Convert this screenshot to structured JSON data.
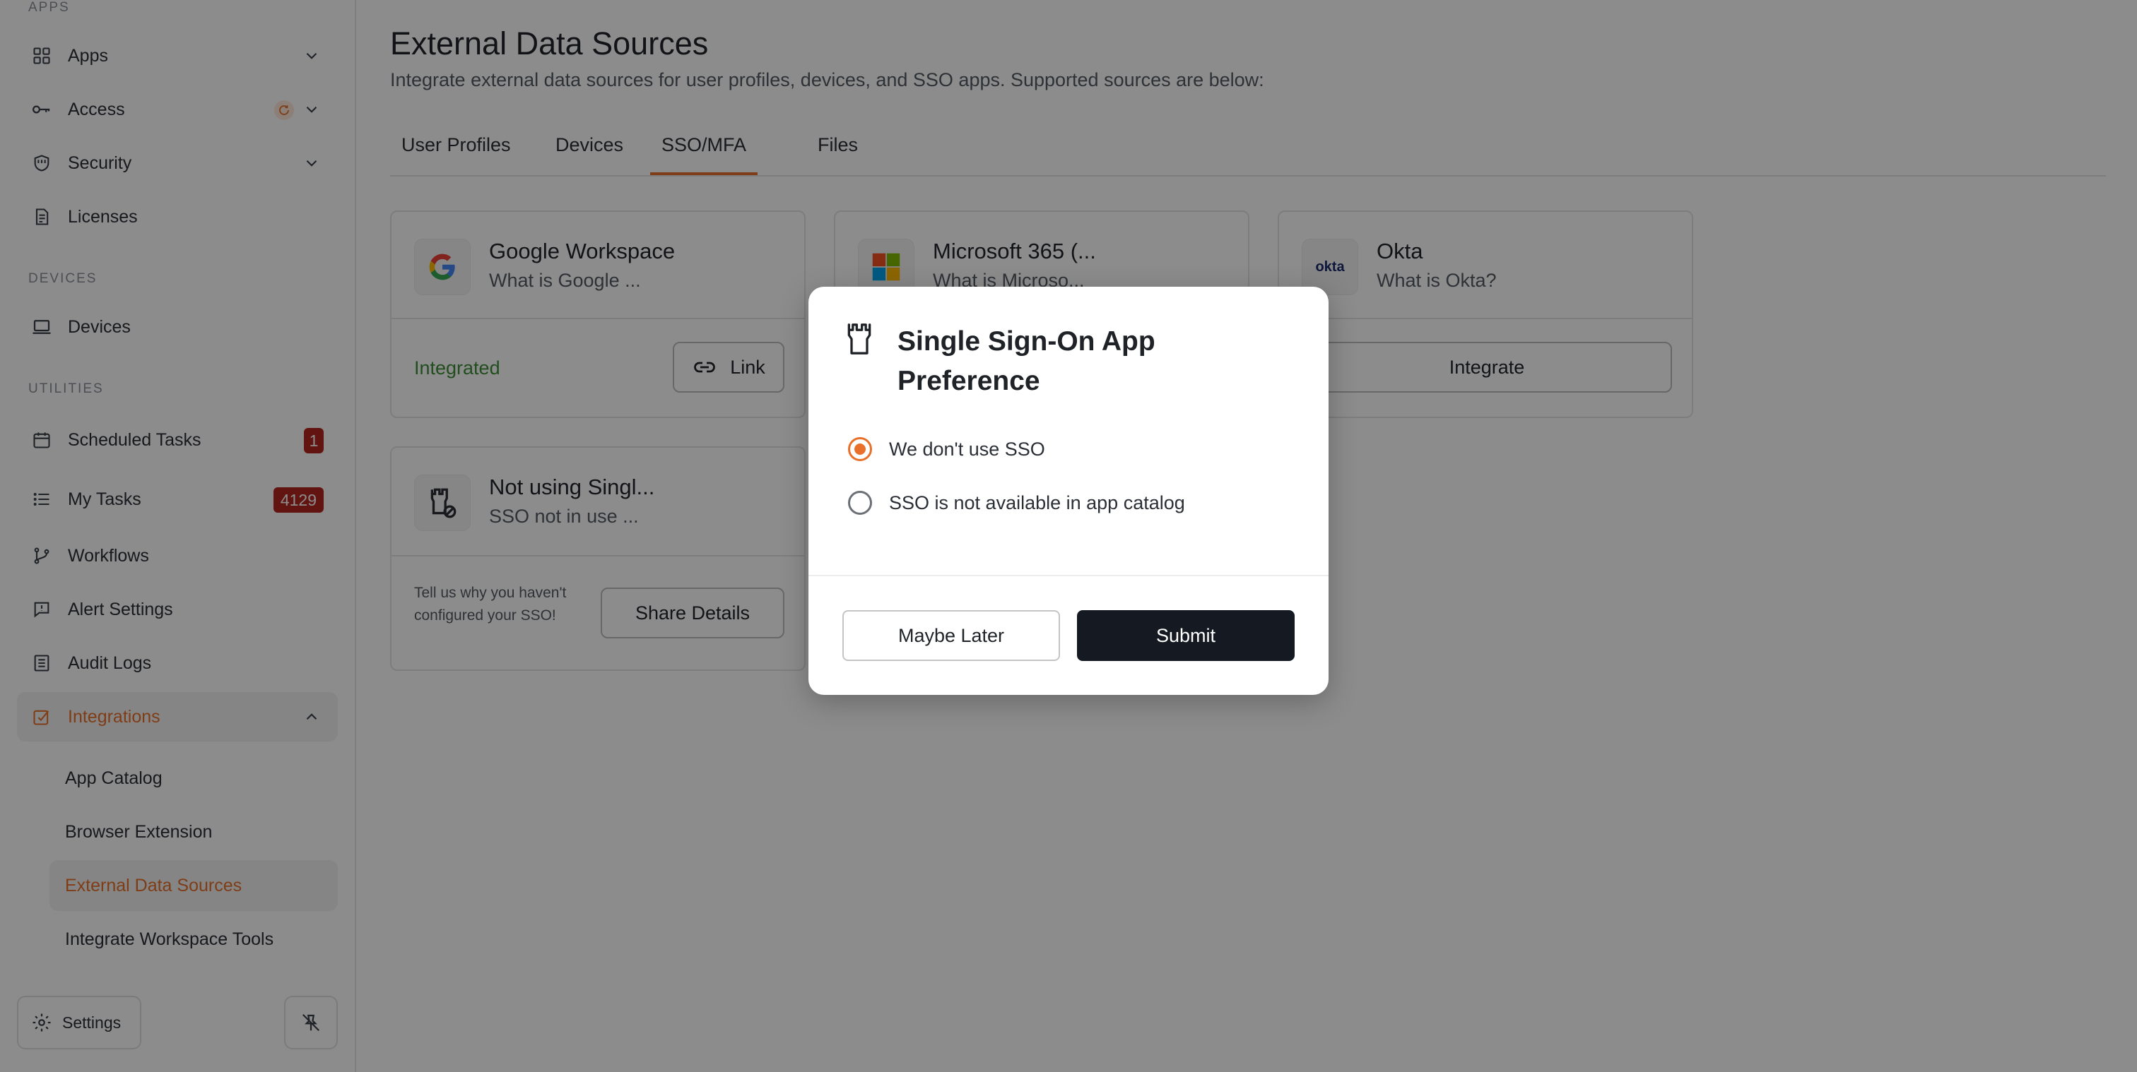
{
  "sidebar": {
    "sections": {
      "apps": "APPS",
      "devices": "DEVICES",
      "utilities": "UTILITIES"
    },
    "items": {
      "apps": "Apps",
      "access": "Access",
      "security": "Security",
      "licenses": "Licenses",
      "devices": "Devices",
      "scheduled_tasks": "Scheduled Tasks",
      "scheduled_tasks_badge": "1",
      "my_tasks": "My Tasks",
      "my_tasks_badge": "4129",
      "workflows": "Workflows",
      "alert_settings": "Alert Settings",
      "audit_logs": "Audit Logs",
      "integrations": "Integrations"
    },
    "sub_items": {
      "app_catalog": "App Catalog",
      "browser_extension": "Browser Extension",
      "external_data_sources": "External Data Sources",
      "integrate_workspace_tools": "Integrate Workspace Tools"
    },
    "settings_label": "Settings",
    "accent_color": "#e8702a"
  },
  "main": {
    "title": "External Data Sources",
    "subtitle": "Integrate external data sources for user profiles, devices, and SSO apps. Supported sources are below:",
    "tabs": [
      "User Profiles",
      "Devices",
      "SSO/MFA",
      "Files"
    ],
    "active_tab": "SSO/MFA",
    "cards": [
      {
        "name": "Google Workspace",
        "desc": "What is Google ...",
        "status": "Integrated",
        "action": "Link"
      },
      {
        "name": "Microsoft 365 (...",
        "desc": "What is Microso..."
      },
      {
        "name": "Okta",
        "desc": "What is Okta?",
        "action": "Integrate",
        "logo_text": "okta"
      },
      {
        "name": "Not using Singl...",
        "desc": "SSO not in use ...",
        "note": "Tell us why you haven't configured your SSO!",
        "action": "Share Details"
      }
    ]
  },
  "modal": {
    "title": "Single Sign-On App Preference",
    "options": [
      "We don't use SSO",
      "SSO is not available in app catalog"
    ],
    "selected_option": "We don't use SSO",
    "cancel_label": "Maybe Later",
    "submit_label": "Submit"
  }
}
